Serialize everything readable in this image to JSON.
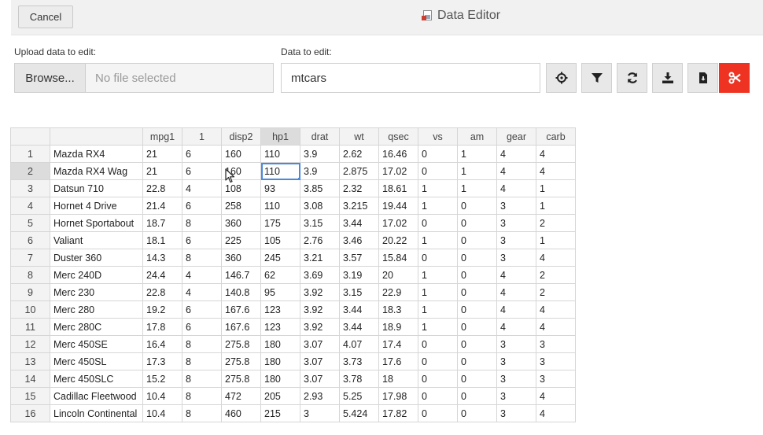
{
  "header": {
    "cancel_label": "Cancel",
    "title": "Data Editor"
  },
  "upload": {
    "label": "Upload data to edit:",
    "browse_label": "Browse...",
    "file_placeholder": "No file selected"
  },
  "data_select": {
    "label": "Data to edit:",
    "value": "mtcars"
  },
  "toolbar": {
    "buttons": [
      "crosshair-icon",
      "filter-icon",
      "sync-icon",
      "download-icon",
      "file-download-icon",
      "cut-icon"
    ],
    "danger_color": "#ee3322"
  },
  "table": {
    "columns": [
      "",
      "mpg1",
      "1",
      "disp2",
      "hp1",
      "drat",
      "wt",
      "qsec",
      "vs",
      "am",
      "gear",
      "carb"
    ],
    "active_column": "hp1",
    "active_row": "2",
    "selected_cell": {
      "row": "2",
      "column": "hp1"
    },
    "rows": [
      [
        "1",
        "Mazda RX4",
        "21",
        "6",
        "160",
        "110",
        "3.9",
        "2.62",
        "16.46",
        "0",
        "1",
        "4",
        "4"
      ],
      [
        "2",
        "Mazda RX4 Wag",
        "21",
        "6",
        "160",
        "110",
        "3.9",
        "2.875",
        "17.02",
        "0",
        "1",
        "4",
        "4"
      ],
      [
        "3",
        "Datsun 710",
        "22.8",
        "4",
        "108",
        "93",
        "3.85",
        "2.32",
        "18.61",
        "1",
        "1",
        "4",
        "1"
      ],
      [
        "4",
        "Hornet 4 Drive",
        "21.4",
        "6",
        "258",
        "110",
        "3.08",
        "3.215",
        "19.44",
        "1",
        "0",
        "3",
        "1"
      ],
      [
        "5",
        "Hornet Sportabout",
        "18.7",
        "8",
        "360",
        "175",
        "3.15",
        "3.44",
        "17.02",
        "0",
        "0",
        "3",
        "2"
      ],
      [
        "6",
        "Valiant",
        "18.1",
        "6",
        "225",
        "105",
        "2.76",
        "3.46",
        "20.22",
        "1",
        "0",
        "3",
        "1"
      ],
      [
        "7",
        "Duster 360",
        "14.3",
        "8",
        "360",
        "245",
        "3.21",
        "3.57",
        "15.84",
        "0",
        "0",
        "3",
        "4"
      ],
      [
        "8",
        "Merc 240D",
        "24.4",
        "4",
        "146.7",
        "62",
        "3.69",
        "3.19",
        "20",
        "1",
        "0",
        "4",
        "2"
      ],
      [
        "9",
        "Merc 230",
        "22.8",
        "4",
        "140.8",
        "95",
        "3.92",
        "3.15",
        "22.9",
        "1",
        "0",
        "4",
        "2"
      ],
      [
        "10",
        "Merc 280",
        "19.2",
        "6",
        "167.6",
        "123",
        "3.92",
        "3.44",
        "18.3",
        "1",
        "0",
        "4",
        "4"
      ],
      [
        "11",
        "Merc 280C",
        "17.8",
        "6",
        "167.6",
        "123",
        "3.92",
        "3.44",
        "18.9",
        "1",
        "0",
        "4",
        "4"
      ],
      [
        "12",
        "Merc 450SE",
        "16.4",
        "8",
        "275.8",
        "180",
        "3.07",
        "4.07",
        "17.4",
        "0",
        "0",
        "3",
        "3"
      ],
      [
        "13",
        "Merc 450SL",
        "17.3",
        "8",
        "275.8",
        "180",
        "3.07",
        "3.73",
        "17.6",
        "0",
        "0",
        "3",
        "3"
      ],
      [
        "14",
        "Merc 450SLC",
        "15.2",
        "8",
        "275.8",
        "180",
        "3.07",
        "3.78",
        "18",
        "0",
        "0",
        "3",
        "3"
      ],
      [
        "15",
        "Cadillac Fleetwood",
        "10.4",
        "8",
        "472",
        "205",
        "2.93",
        "5.25",
        "17.98",
        "0",
        "0",
        "3",
        "4"
      ],
      [
        "16",
        "Lincoln Continental",
        "10.4",
        "8",
        "460",
        "215",
        "3",
        "5.424",
        "17.82",
        "0",
        "0",
        "3",
        "4"
      ]
    ]
  }
}
